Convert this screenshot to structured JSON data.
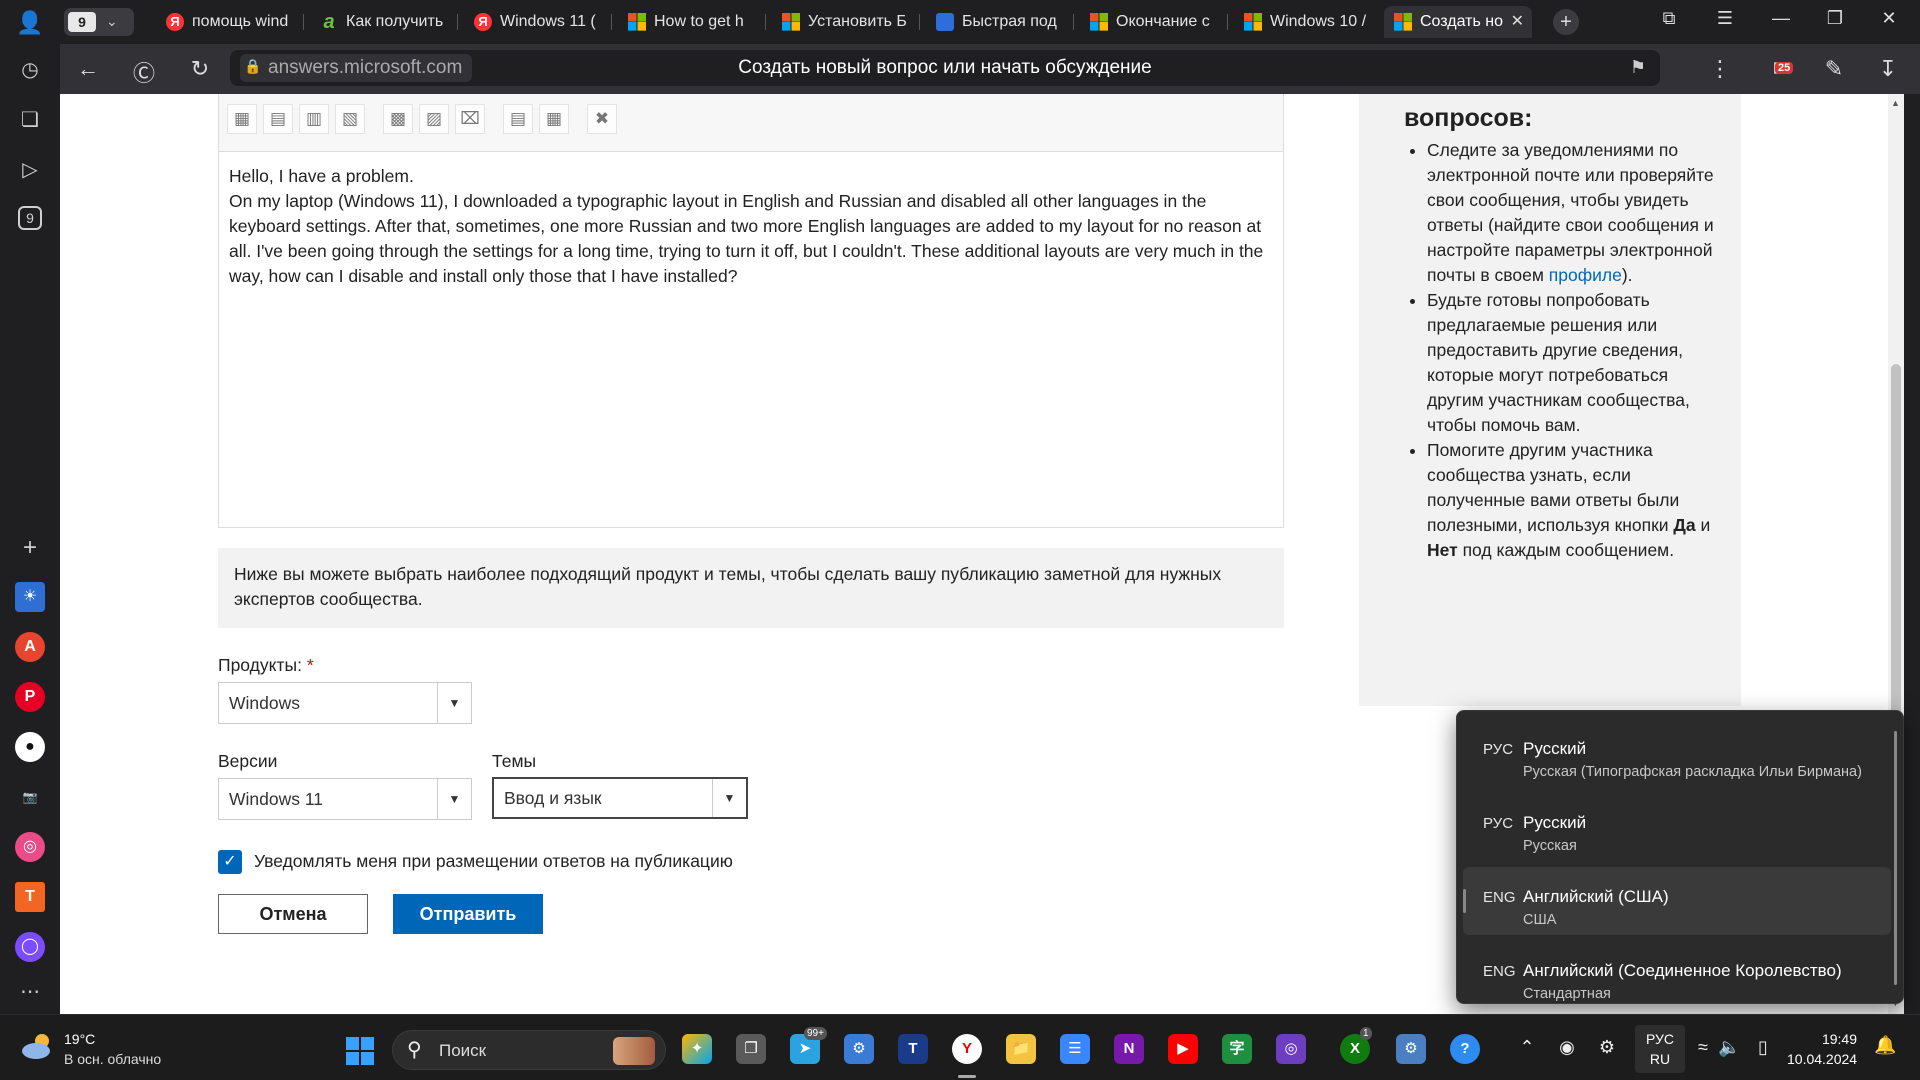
{
  "browser": {
    "tab_count": "9",
    "tabs": [
      {
        "title": "помощь wind",
        "icon": "yandex-icon"
      },
      {
        "title": "Как получить",
        "icon": "answers-icon"
      },
      {
        "title": "Windows 11 (",
        "icon": "yandex-icon"
      },
      {
        "title": "How to get h",
        "icon": "microsoft-icon"
      },
      {
        "title": "Установить Б",
        "icon": "microsoft-icon"
      },
      {
        "title": "Быстрая под",
        "icon": "store-icon"
      },
      {
        "title": "Окончание с",
        "icon": "microsoft-icon"
      },
      {
        "title": "Windows 10 /",
        "icon": "microsoft-icon"
      },
      {
        "title": "Создать но",
        "icon": "microsoft-icon",
        "active": true
      }
    ],
    "address_host": "answers.microsoft.com",
    "page_title": "Создать новый вопрос или начать обсуждение",
    "notification_badge": "25",
    "sidebar_badge": "9"
  },
  "editor": {
    "lines": [
      "Hello, I have a problem.",
      "On my laptop (Windows 11), I downloaded a typographic layout in English and Russian and disabled all other languages in the keyboard settings. After that, sometimes, one more Russian and two more English languages are added to my layout for no reason at all. I've been going through the settings for a long time, trying to turn it off, but I couldn't. These additional layouts are very much in the way, how can I disable and install only those that I have installed?"
    ]
  },
  "info_text": "Ниже вы можете выбрать наиболее подходящий продукт и темы, чтобы сделать вашу публикацию заметной для нужных экспертов сообщества.",
  "form": {
    "products_label": "Продукты:",
    "required_mark": "*",
    "products_value": "Windows",
    "versions_label": "Версии",
    "versions_value": "Windows 11",
    "topics_label": "Темы",
    "topics_value": "Ввод и язык",
    "notify_label": "Уведомлять меня при размещении ответов на публикацию",
    "notify_checked": true,
    "cancel_label": "Отмена",
    "submit_label": "Отправить"
  },
  "right_panel": {
    "heading": "вопросов:",
    "items": [
      {
        "pre": "Следите за уведомлениями по электронной почте или проверяйте свои сообщения, чтобы увидеть ответы (найдите свои сообщения и настройте параметры электронной почты в своем ",
        "link": "профиле",
        "post": ")."
      },
      {
        "text": "Будьте готовы попробовать предлагаемые решения или предоставить другие сведения, которые могут потребоваться другим участникам сообщества, чтобы помочь вам."
      },
      {
        "pre": "Помогите другим участника сообщества узнать, если полученные вами ответы были полезными, используя кнопки ",
        "b1": "Да",
        "mid": " и ",
        "b2": "Нет",
        "post": " под каждым сообщением."
      }
    ]
  },
  "language_flyout": {
    "items": [
      {
        "abbr": "РУС",
        "name": "Русский",
        "layout": "Русская (Типографская раскладка Ильи Бирмана)"
      },
      {
        "abbr": "РУС",
        "name": "Русский",
        "layout": "Русская"
      },
      {
        "abbr": "ENG",
        "name": "Английский (США)",
        "layout": "США",
        "selected": true
      },
      {
        "abbr": "ENG",
        "name": "Английский (Соединенное Королевство)",
        "layout": "Стандартная"
      }
    ]
  },
  "taskbar": {
    "weather_temp": "19°C",
    "weather_desc": "В осн. облачно",
    "search_label": "Поиск",
    "telegram_badge": "99+",
    "xbox_badge": "1",
    "lang_line1": "РУС",
    "lang_line2": "RU",
    "time": "19:49",
    "date": "10.04.2024"
  },
  "colors": {
    "accent": "#0067b8",
    "tab_strip": "#1f1f22",
    "taskbar": "#1c1c1c"
  }
}
